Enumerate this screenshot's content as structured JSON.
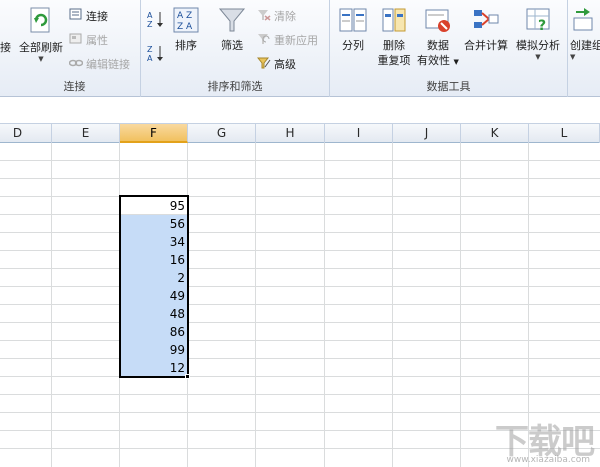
{
  "ribbon": {
    "connections": {
      "group_label": "连接",
      "refresh_all": "全部刷新",
      "connections": "连接",
      "properties": "属性",
      "edit_links": "编辑链接"
    },
    "sort_filter": {
      "group_label": "排序和筛选",
      "sort": "排序",
      "filter": "筛选",
      "clear": "清除",
      "reapply": "重新应用",
      "advanced": "高级"
    },
    "data_tools": {
      "group_label": "数据工具",
      "text_to_columns": "分列",
      "remove_dup_line1": "删除",
      "remove_dup_line2": "重复项",
      "validation_line1": "数据",
      "validation_line2": "有效性",
      "consolidate": "合并计算",
      "what_if": "模拟分析"
    },
    "outline": {
      "create_group": "创建组"
    },
    "left_cut": "接"
  },
  "columns": [
    "D",
    "E",
    "F",
    "G",
    "H",
    "I",
    "J",
    "K",
    "L"
  ],
  "active_column": "F",
  "cells": [
    "95",
    "56",
    "34",
    "16",
    "2",
    "49",
    "48",
    "86",
    "99",
    "12"
  ],
  "watermark": {
    "main": "下载吧",
    "sub": "www.xiazaiba.com"
  }
}
